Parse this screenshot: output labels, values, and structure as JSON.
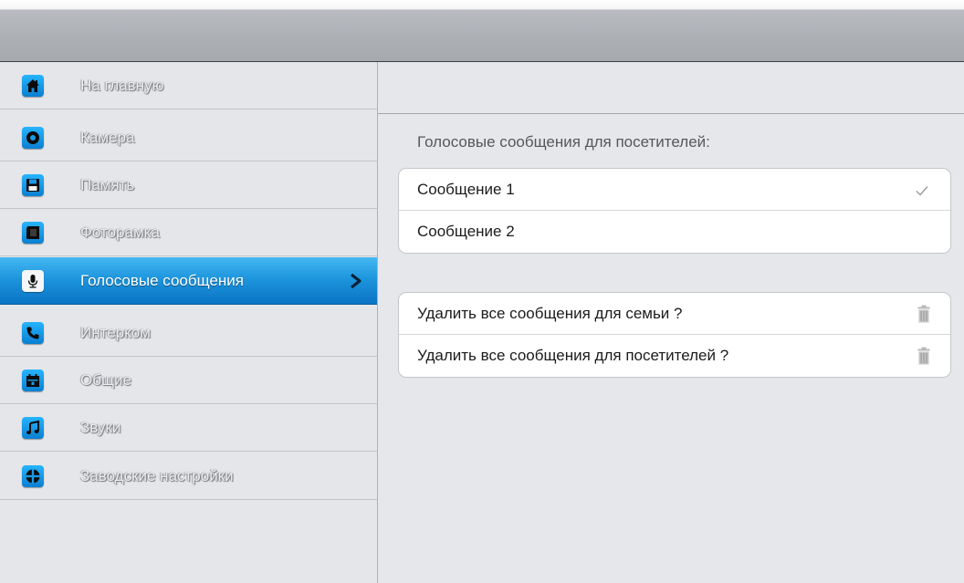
{
  "sidebar": {
    "items": [
      {
        "label": "На главную",
        "icon": "home-icon"
      },
      {
        "label": "Камера",
        "icon": "camera-icon"
      },
      {
        "label": "Память",
        "icon": "floppy-disk-icon"
      },
      {
        "label": "Фоторамка",
        "icon": "photo-frame-icon"
      },
      {
        "label": "Голосовые сообщения",
        "icon": "microphone-icon",
        "active": true
      },
      {
        "label": "Интерком",
        "icon": "phone-icon"
      },
      {
        "label": "Общие",
        "icon": "calendar-icon"
      },
      {
        "label": "Звуки",
        "icon": "music-note-icon"
      },
      {
        "label": "Заводские настройки",
        "icon": "factory-reset-icon"
      }
    ]
  },
  "main": {
    "section_title": "Голосовые сообщения для посетителей:",
    "messages": [
      {
        "label": "Сообщение 1",
        "selected": true
      },
      {
        "label": "Сообщение 2",
        "selected": false
      }
    ],
    "actions": [
      {
        "label": "Удалить все сообщения для семьи ?",
        "icon": "trash-icon"
      },
      {
        "label": "Удалить все сообщения для посетителей ?",
        "icon": "trash-icon"
      }
    ]
  },
  "colors": {
    "accent": "#1c94dc",
    "icon_blue": "#0a7fd0",
    "sidebar_bg": "#e5e6ea",
    "main_bg": "#e6e7eb"
  }
}
